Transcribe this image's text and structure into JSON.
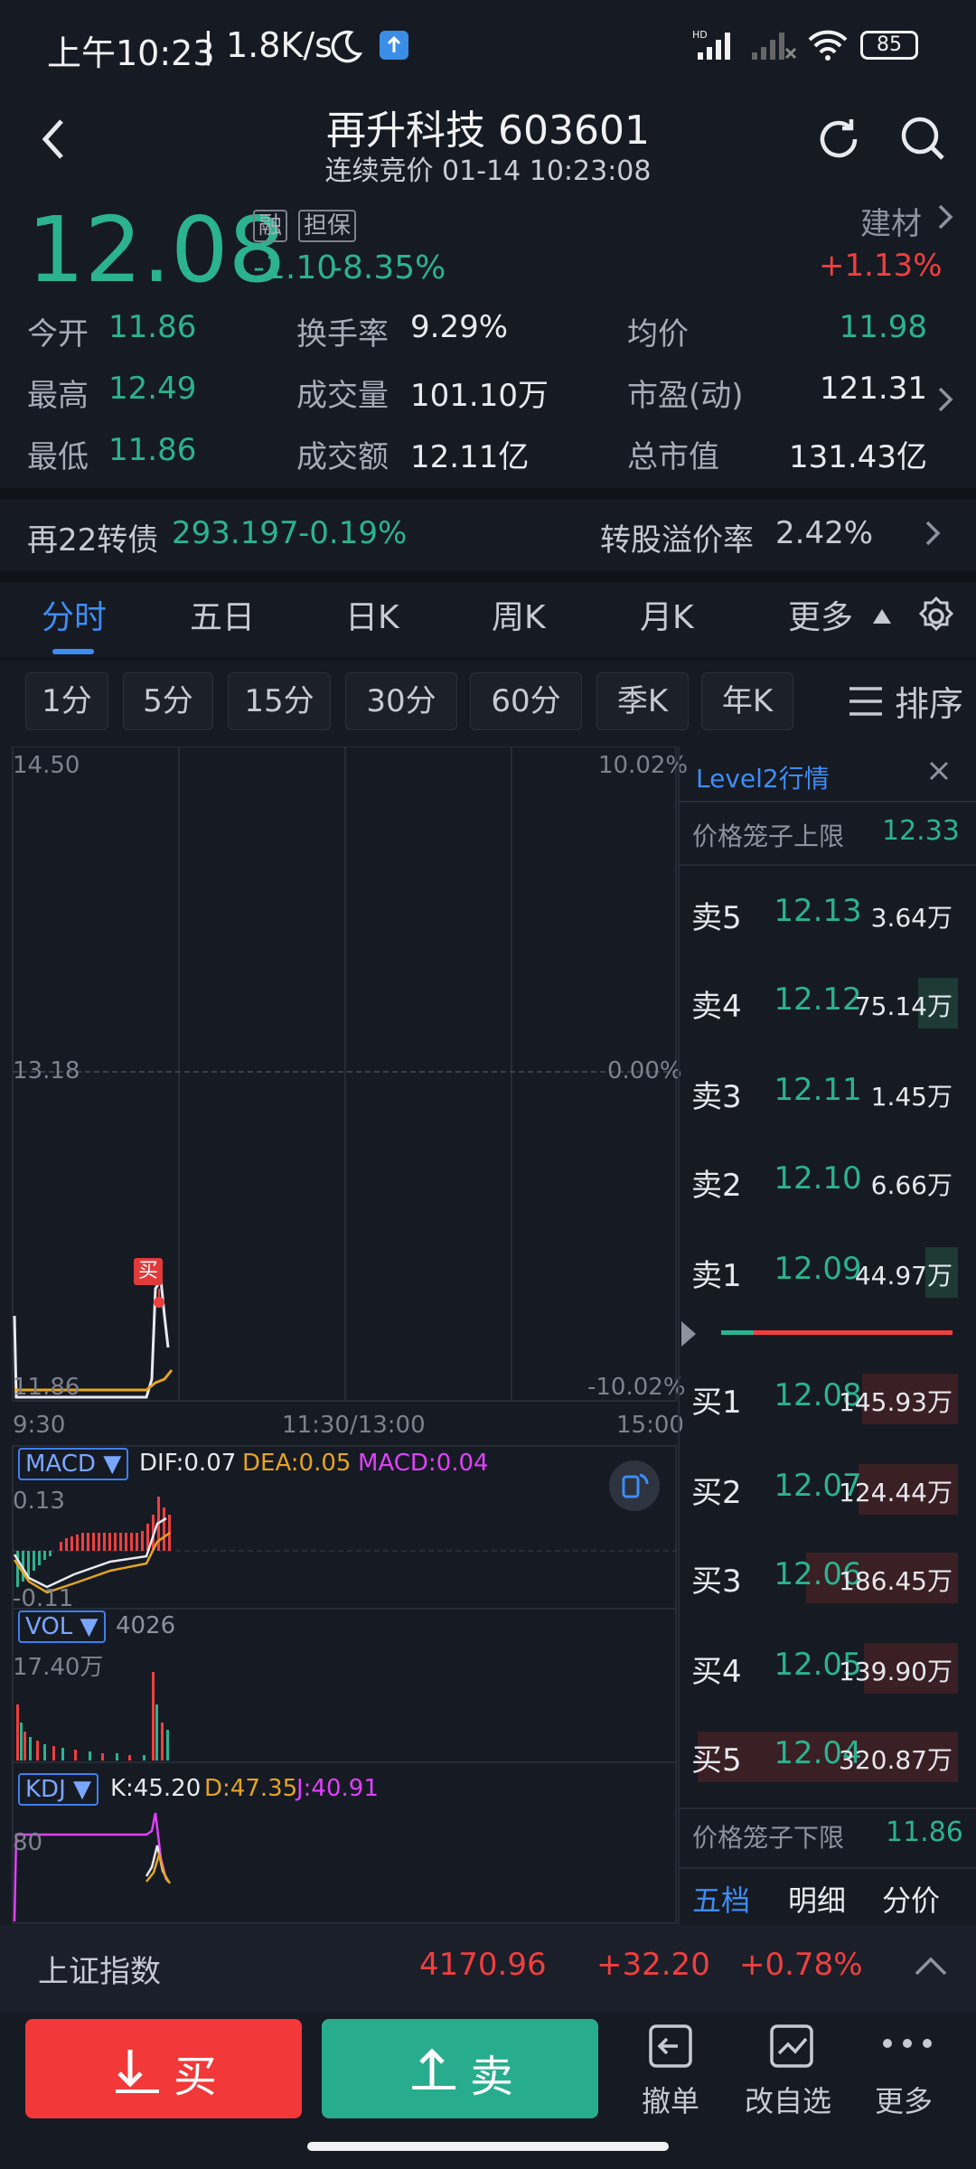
{
  "status_bar": {
    "time": "上午10:23",
    "speed": "1.8K/s",
    "battery": "85"
  },
  "header": {
    "title": "再升科技 603601",
    "subtitle": "连续竞价 01-14 10:23:08"
  },
  "quote": {
    "price": "12.08",
    "badge_margin": "融",
    "badge_pledge": "担保",
    "change": "-1.10",
    "change_pct": "-8.35%",
    "sector": "建材",
    "sector_change": "+1.13%"
  },
  "stats": {
    "open_label": "今开",
    "open": "11.86",
    "high_label": "最高",
    "high": "12.49",
    "low_label": "最低",
    "low": "11.86",
    "turnover_label": "换手率",
    "turnover": "9.29%",
    "volume_label": "成交量",
    "volume": "101.10万",
    "amount_label": "成交额",
    "amount": "12.11亿",
    "avg_label": "均价",
    "avg": "11.98",
    "pe_label": "市盈(动)",
    "pe": "121.31",
    "mcap_label": "总市值",
    "mcap": "131.43亿"
  },
  "bond": {
    "name": "再22转债",
    "price": "293.197",
    "change": "-0.19%",
    "premium_label": "转股溢价率",
    "premium": "2.42%"
  },
  "tabs": [
    "分时",
    "五日",
    "日K",
    "周K",
    "月K",
    "更多"
  ],
  "chips": [
    "1分",
    "5分",
    "15分",
    "30分",
    "60分",
    "季K",
    "年K"
  ],
  "sort_label": "排序",
  "chart": {
    "price_top": "14.50",
    "pct_top": "10.02%",
    "price_mid": "13.18",
    "pct_mid": "0.00%",
    "price_bottom": "11.86",
    "pct_bottom": "-10.02%",
    "time_start": "9:30",
    "time_mid": "11:30/13:00",
    "time_end": "15:00",
    "buy_marker": "买"
  },
  "macd": {
    "label": "MACD ▼",
    "dif": "DIF:0.07",
    "dea": "DEA:0.05",
    "macd": "MACD:0.04",
    "top": "0.13",
    "bottom": "-0.11"
  },
  "vol": {
    "label": "VOL ▼",
    "value": "4026",
    "top": "17.40万"
  },
  "kdj": {
    "label": "KDJ ▼",
    "k": "K:45.20",
    "d": "D:47.35",
    "j": "J:40.91",
    "level": "80"
  },
  "level2": {
    "title": "Level2行情",
    "upper_label": "价格笼子上限",
    "upper": "12.33",
    "lower_label": "价格笼子下限",
    "lower": "11.86",
    "asks": [
      {
        "label": "卖5",
        "price": "12.13",
        "vol": "3.64万"
      },
      {
        "label": "卖4",
        "price": "12.12",
        "vol": "75.14万"
      },
      {
        "label": "卖3",
        "price": "12.11",
        "vol": "1.45万"
      },
      {
        "label": "卖2",
        "price": "12.10",
        "vol": "6.66万"
      },
      {
        "label": "卖1",
        "price": "12.09",
        "vol": "44.97万"
      }
    ],
    "bids": [
      {
        "label": "买1",
        "price": "12.08",
        "vol": "145.93万"
      },
      {
        "label": "买2",
        "price": "12.07",
        "vol": "124.44万"
      },
      {
        "label": "买3",
        "price": "12.06",
        "vol": "186.45万"
      },
      {
        "label": "买4",
        "price": "12.05",
        "vol": "139.90万"
      },
      {
        "label": "买5",
        "price": "12.04",
        "vol": "320.87万"
      }
    ],
    "tabs": [
      "五档",
      "明细",
      "分价"
    ]
  },
  "index_bar": {
    "name": "上证指数",
    "value": "4170.96",
    "change": "+32.20",
    "pct": "+0.78%"
  },
  "actions": {
    "buy": "买",
    "sell": "卖",
    "cancel": "撤单",
    "watch": "改自选",
    "more": "更多"
  }
}
